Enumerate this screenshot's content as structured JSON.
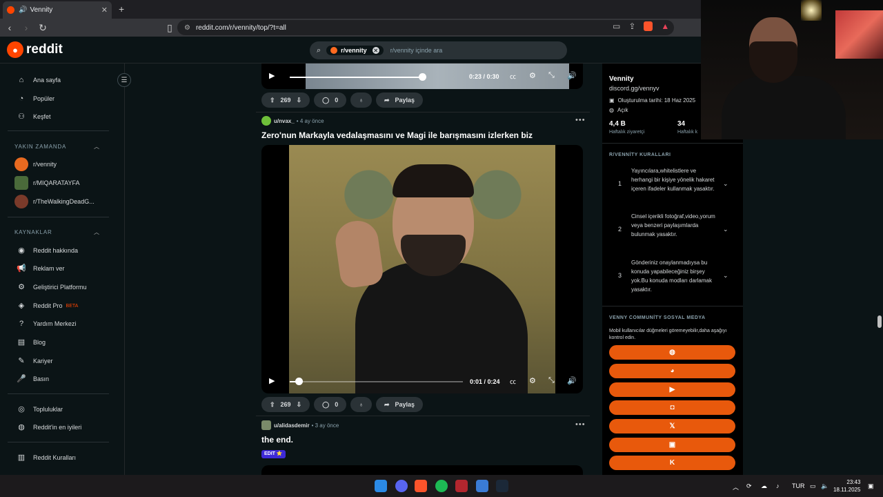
{
  "browser": {
    "tab_title": "Vennity",
    "url": "reddit.com/r/vennity/top/?t=all"
  },
  "header": {
    "logo_text": "reddit",
    "search_chip": "r/vennity",
    "search_placeholder": "r/vennity içinde ara"
  },
  "sidebar": {
    "nav": [
      "Ana sayfa",
      "Popüler",
      "Keşfet"
    ],
    "recent_title": "YAKIN ZAMANDA",
    "recent": [
      "r/vennity",
      "r/MIQARATAYFA",
      "r/TheWalkingDeadG..."
    ],
    "resources_title": "KAYNAKLAR",
    "resources": [
      "Reddit hakkında",
      "Reklam ver",
      "Geliştirici Platformu",
      "Reddit Pro",
      "Yardım Merkezi",
      "Blog",
      "Kariyer",
      "Basın"
    ],
    "beta": "BETA",
    "community": [
      "Topluluklar",
      "Reddit'in en iyileri"
    ],
    "rules": [
      "Reddit Kuralları"
    ]
  },
  "posts": {
    "top_video": {
      "time": "0:23 / 0:30",
      "progress": 0.76
    },
    "top_actions": {
      "votes": "269",
      "comments": "0",
      "share": "Paylaş"
    },
    "post1": {
      "user": "u/nvax_",
      "age": "• 4 ay önce",
      "title": "Zero'nun Markayla vedalaşmasını ve Magi ile barışmasını izlerken biz",
      "time": "0:01 / 0:24",
      "progress": 0.05,
      "votes": "269",
      "comments": "0",
      "share": "Paylaş"
    },
    "post2": {
      "user": "u/alidasdemir",
      "age": "• 3 ay önce",
      "title": "the end.",
      "flair": "EDIT ⭐"
    }
  },
  "right_panel": {
    "name": "Vennity",
    "link": "discord.gg/vennyv",
    "created": "Oluşturulma tarihi: 18 Haz 2025",
    "visibility": "Açık",
    "stat1_value": "4,4 B",
    "stat1_label": "Haftalık ziyaretçi",
    "stat2_value": "34",
    "stat2_label": "Haftalık k",
    "rules_title": "R/VENNİTY KURALLARI",
    "rules": [
      {
        "num": "1",
        "text": "Yayıncılara,whitelistlere ve herhangi bir kişiye yönelik hakaret içeren ifadeler kullanmak yasaktır."
      },
      {
        "num": "2",
        "text": "Cinsel içerikli fotoğraf,video,yorum veya benzeri paylaşımlarda bulunmak yasaktır."
      },
      {
        "num": "3",
        "text": "Gönderiniz onaylanmadıysa bu konuda yapabileceğiniz birşey yok.Bu konuda modları darlamak yasaktır."
      }
    ],
    "social_title": "VENNY COMMUNİTY SOSYAL MEDYA",
    "social_desc": "Mobil kullanıcılar düğmeleri göremeyebilir,daha aşağıyı kontrol edin.",
    "social_icons": [
      "globe-icon",
      "discord-icon",
      "youtube-icon",
      "instagram-icon",
      "x-icon",
      "twitch-icon",
      "kick-icon"
    ]
  },
  "taskbar": {
    "lang": "TUR",
    "time": "23:43",
    "date": "18.11.2025"
  },
  "colors": {
    "accent": "#ff4500",
    "social_button": "#e8590c",
    "background": "#0b1416"
  }
}
